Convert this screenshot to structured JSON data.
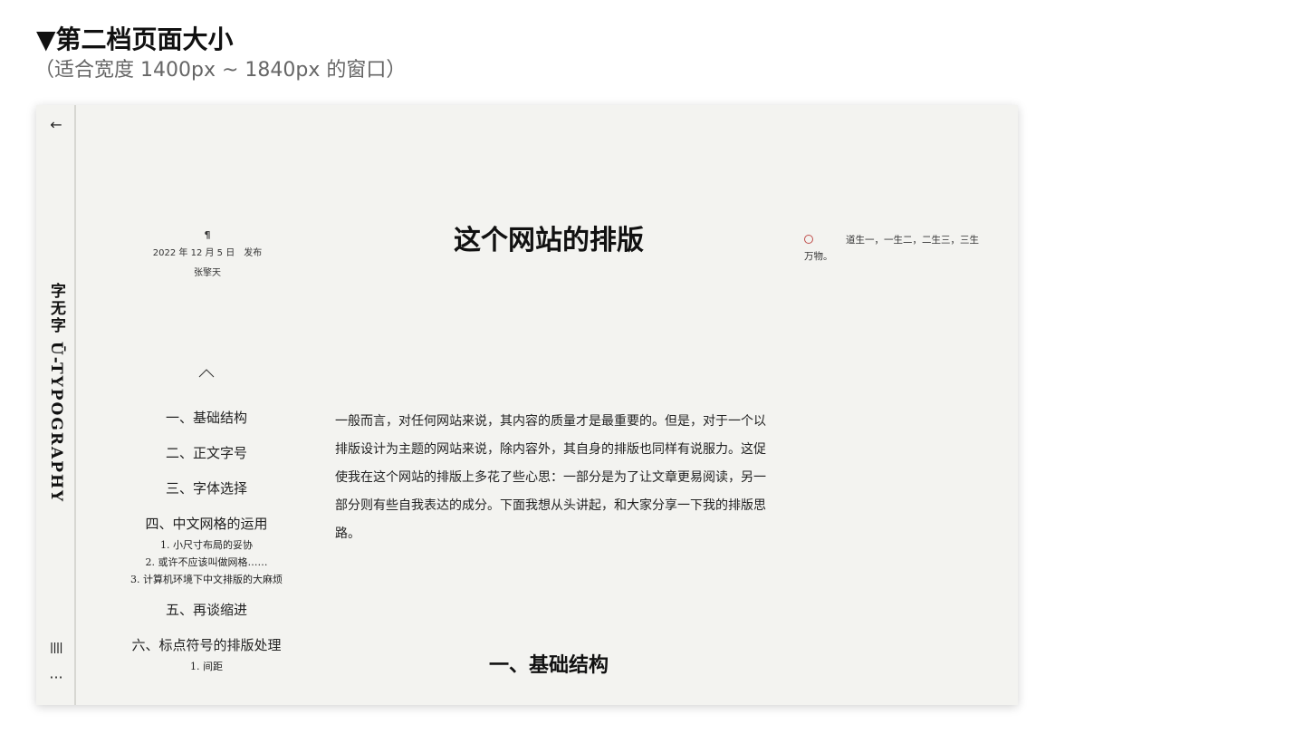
{
  "page": {
    "heading": "▼第二档页面大小",
    "subheading": "（适合宽度 1400px ~ 1840px 的窗口）"
  },
  "sidebar": {
    "back_icon": "←",
    "brand": "字无字 Ū-TYPOGRAPHY",
    "more_icon": "···"
  },
  "meta": {
    "pilcrow": "¶",
    "date": "2022 年 12 月 5 日　发布",
    "author": "张擎天"
  },
  "toc": {
    "items": [
      {
        "label": "一、基础结构"
      },
      {
        "label": "二、正文字号"
      },
      {
        "label": "三、字体选择"
      },
      {
        "label": "四、中文网格的运用"
      },
      {
        "label": "五、再谈缩进"
      },
      {
        "label": "六、标点符号的排版处理"
      }
    ],
    "subitems_4": [
      "1. 小尺寸布局的妥协",
      "2. 或许不应该叫做网格……",
      "3. 计算机环境下中文排版的大麻烦"
    ],
    "subitem_6_1": "1. 间距"
  },
  "article": {
    "title": "这个网站的排版",
    "body": "一般而言，对任何网站来说，其内容的质量才是最重要的。但是，对于一个以排版设计为主题的网站来说，除内容外，其自身的排版也同样有说服力。这促使我在这个网站的排版上多花了些心思：一部分是为了让文章更易阅读，另一部分则有些自我表达的成分。下面我想从头讲起，和大家分享一下我的排版思路。",
    "section_heading": "一、基础结构"
  },
  "sidenote": {
    "text": "道生一，一生二，二生三，三生万物。"
  },
  "colors": {
    "page_bg": "#f3f3f0",
    "accent_circle": "#c0504d"
  }
}
